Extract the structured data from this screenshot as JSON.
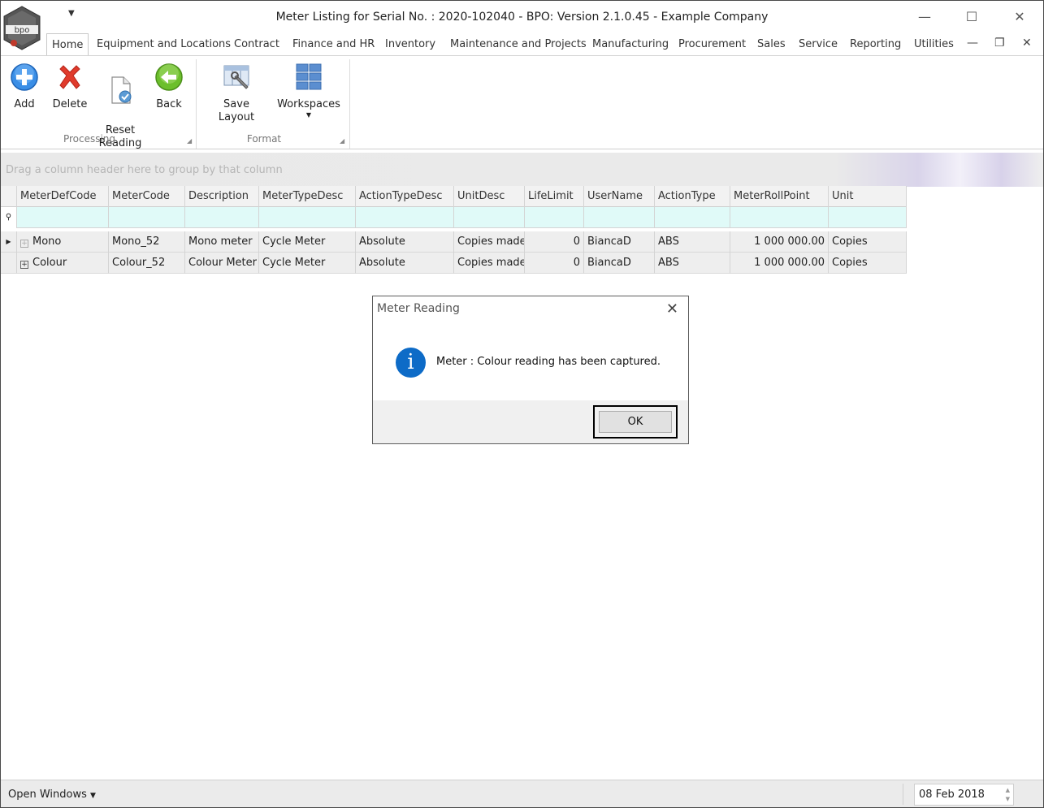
{
  "window": {
    "title": "Meter Listing for Serial No. : 2020-102040 - BPO: Version 2.1.0.45 - Example Company",
    "logo_text": "bpo"
  },
  "tabs": [
    "Home",
    "Equipment and Locations",
    "Contract",
    "Finance and HR",
    "Inventory",
    "Maintenance and Projects",
    "Manufacturing",
    "Procurement",
    "Sales",
    "Service",
    "Reporting",
    "Utilities"
  ],
  "ribbon": {
    "processing": {
      "label": "Processing",
      "buttons": [
        {
          "label": "Add",
          "icon": "add-icon"
        },
        {
          "label": "Delete",
          "icon": "delete-icon"
        },
        {
          "label": "Reset\nReading",
          "icon": "reset-reading-icon"
        },
        {
          "label": "Back",
          "icon": "back-icon"
        }
      ]
    },
    "format": {
      "label": "Format",
      "buttons": [
        {
          "label": "Save Layout",
          "icon": "save-layout-icon"
        },
        {
          "label": "Workspaces",
          "icon": "workspaces-icon"
        }
      ]
    }
  },
  "grid": {
    "group_panel_hint": "Drag a column header here to group by that column",
    "columns": [
      "MeterDefCode",
      "MeterCode",
      "Description",
      "MeterTypeDesc",
      "ActionTypeDesc",
      "UnitDesc",
      "LifeLimit",
      "UserName",
      "ActionType",
      "MeterRollPoint",
      "Unit"
    ],
    "rows": [
      [
        "Mono",
        "Mono_52",
        "Mono meter",
        "Cycle Meter",
        "Absolute",
        "Copies made",
        "0",
        "BiancaD",
        "ABS",
        "1 000 000.00",
        "Copies"
      ],
      [
        "Colour",
        "Colour_52",
        "Colour Meter",
        "Cycle Meter",
        "Absolute",
        "Copies made",
        "0",
        "BiancaD",
        "ABS",
        "1 000 000.00",
        "Copies"
      ]
    ]
  },
  "dialog": {
    "title": "Meter Reading",
    "message": "Meter : Colour reading has been captured.",
    "ok_label": "OK",
    "icon": "info-icon"
  },
  "statusbar": {
    "open_windows": "Open Windows",
    "date": "08 Feb 2018"
  },
  "colors": {
    "accent_blue": "#0d6bc7",
    "filter_row": "#e0faf8"
  }
}
